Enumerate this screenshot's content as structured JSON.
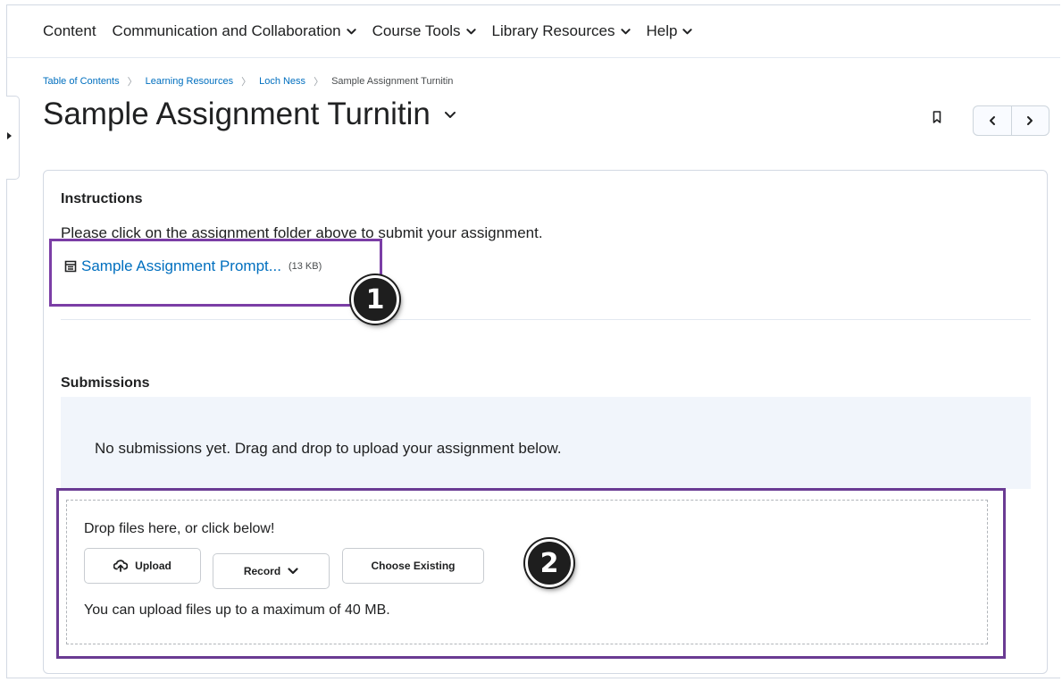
{
  "nav": {
    "items": [
      {
        "label": "Content",
        "dropdown": false
      },
      {
        "label": "Communication and Collaboration",
        "dropdown": true
      },
      {
        "label": "Course Tools",
        "dropdown": true
      },
      {
        "label": "Library Resources",
        "dropdown": true
      },
      {
        "label": "Help",
        "dropdown": true
      }
    ]
  },
  "breadcrumb": {
    "items": [
      "Table of Contents",
      "Learning Resources",
      "Loch Ness"
    ],
    "current": "Sample Assignment Turnitin"
  },
  "page": {
    "title": "Sample Assignment Turnitin"
  },
  "instructions": {
    "heading": "Instructions",
    "text": "Please click on the assignment folder above to submit your assignment.",
    "file_name": "Sample Assignment Prompt...",
    "file_size": "(13 KB)"
  },
  "submissions": {
    "heading": "Submissions",
    "empty_text": "No submissions yet. Drag and drop to upload your assignment below."
  },
  "dropzone": {
    "prompt": "Drop files here, or click below!",
    "upload_label": "Upload",
    "record_label": "Record",
    "choose_existing_label": "Choose Existing",
    "limit_text": "You can upload files up to a maximum of 40 MB."
  },
  "callouts": {
    "badge1": "1",
    "badge2": "2",
    "color": "#7b3ea6"
  },
  "colors": {
    "link": "#006fbf",
    "submissions_bg": "#f1f5fb"
  }
}
